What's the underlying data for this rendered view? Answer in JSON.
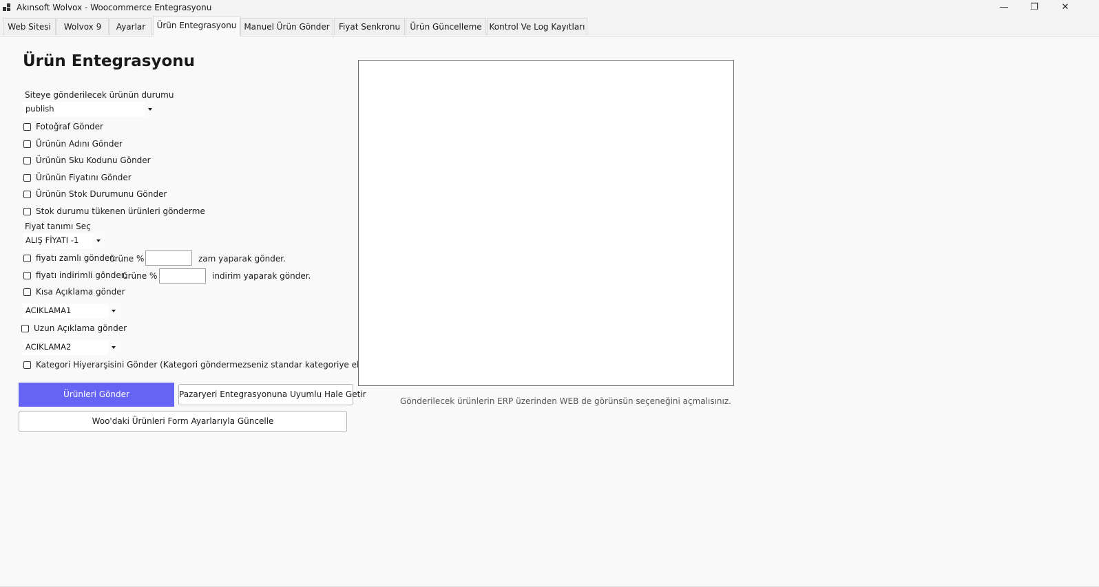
{
  "window": {
    "title": "Akınsoft Wolvox - Woocommerce Entegrasyonu",
    "controls": {
      "minimize": "—",
      "restore": "❐",
      "close": "✕"
    }
  },
  "tabs": [
    {
      "label": "Web Sitesi",
      "active": false
    },
    {
      "label": "Wolvox 9",
      "active": false
    },
    {
      "label": "Ayarlar",
      "active": false
    },
    {
      "label": "Ürün Entegrasyonu",
      "active": true
    },
    {
      "label": "Manuel Ürün Gönder",
      "active": false
    },
    {
      "label": "Fiyat Senkronu",
      "active": false
    },
    {
      "label": "Ürün Güncelleme",
      "active": false
    },
    {
      "label": "Kontrol Ve Log Kayıtları",
      "active": false
    }
  ],
  "form": {
    "title": "Ürün Entegrasyonu",
    "status_label": "Siteye gönderilecek ürünün durumu",
    "status_value": "publish",
    "checkboxes": {
      "photo": {
        "label": "Fotoğraf Gönder",
        "checked": false
      },
      "name": {
        "label": "Ürünün Adını Gönder",
        "checked": false
      },
      "sku": {
        "label": "Ürünün Sku Kodunu Gönder",
        "checked": false
      },
      "price": {
        "label": "Ürünün Fiyatını Gönder",
        "checked": false
      },
      "stock": {
        "label": "Ürünün Stok Durumunu Gönder",
        "checked": false
      },
      "no_out_of_stock": {
        "label": "Stok durumu tükenen ürünleri gönderme",
        "checked": false
      },
      "markup": {
        "label": "fiyatı zamlı gönder:",
        "checked": false
      },
      "discount": {
        "label": "fiyatı indirimli gönder:",
        "checked": false
      },
      "short_desc": {
        "label": "Kısa Açıklama gönder",
        "checked": false
      },
      "long_desc": {
        "label": "Uzun Açıklama gönder",
        "checked": false
      },
      "category": {
        "label": "Kategori Hiyerarşisini Gönder (Kategori göndermezseniz standar kategoriye eklenir)",
        "checked": false
      }
    },
    "price_def_label": "Fiyat tanımı Seç",
    "price_def_value": "ALIŞ FİYATI -1",
    "markup": {
      "prefix": "ürüne %",
      "value": "",
      "suffix": "zam yaparak gönder."
    },
    "discount": {
      "prefix": "ürüne %",
      "value": "",
      "suffix": "indirim yaparak gönder."
    },
    "short_desc_value": "ACIKLAMA1",
    "long_desc_value": "ACIKLAMA2"
  },
  "buttons": {
    "send": "Ürünleri Gönder",
    "marketplace": "Pazaryeri Entegrasyonuna Uyumlu Hale Getir",
    "update_woo": "Woo'daki Ürünleri Form Ayarlarıyla Güncelle"
  },
  "note": "Gönderilecek ürünlerin ERP üzerinden WEB de görünsün seçeneğini açmalısınız.",
  "colors": {
    "primary_button": "#6664f5",
    "background": "#f9f9f9"
  }
}
